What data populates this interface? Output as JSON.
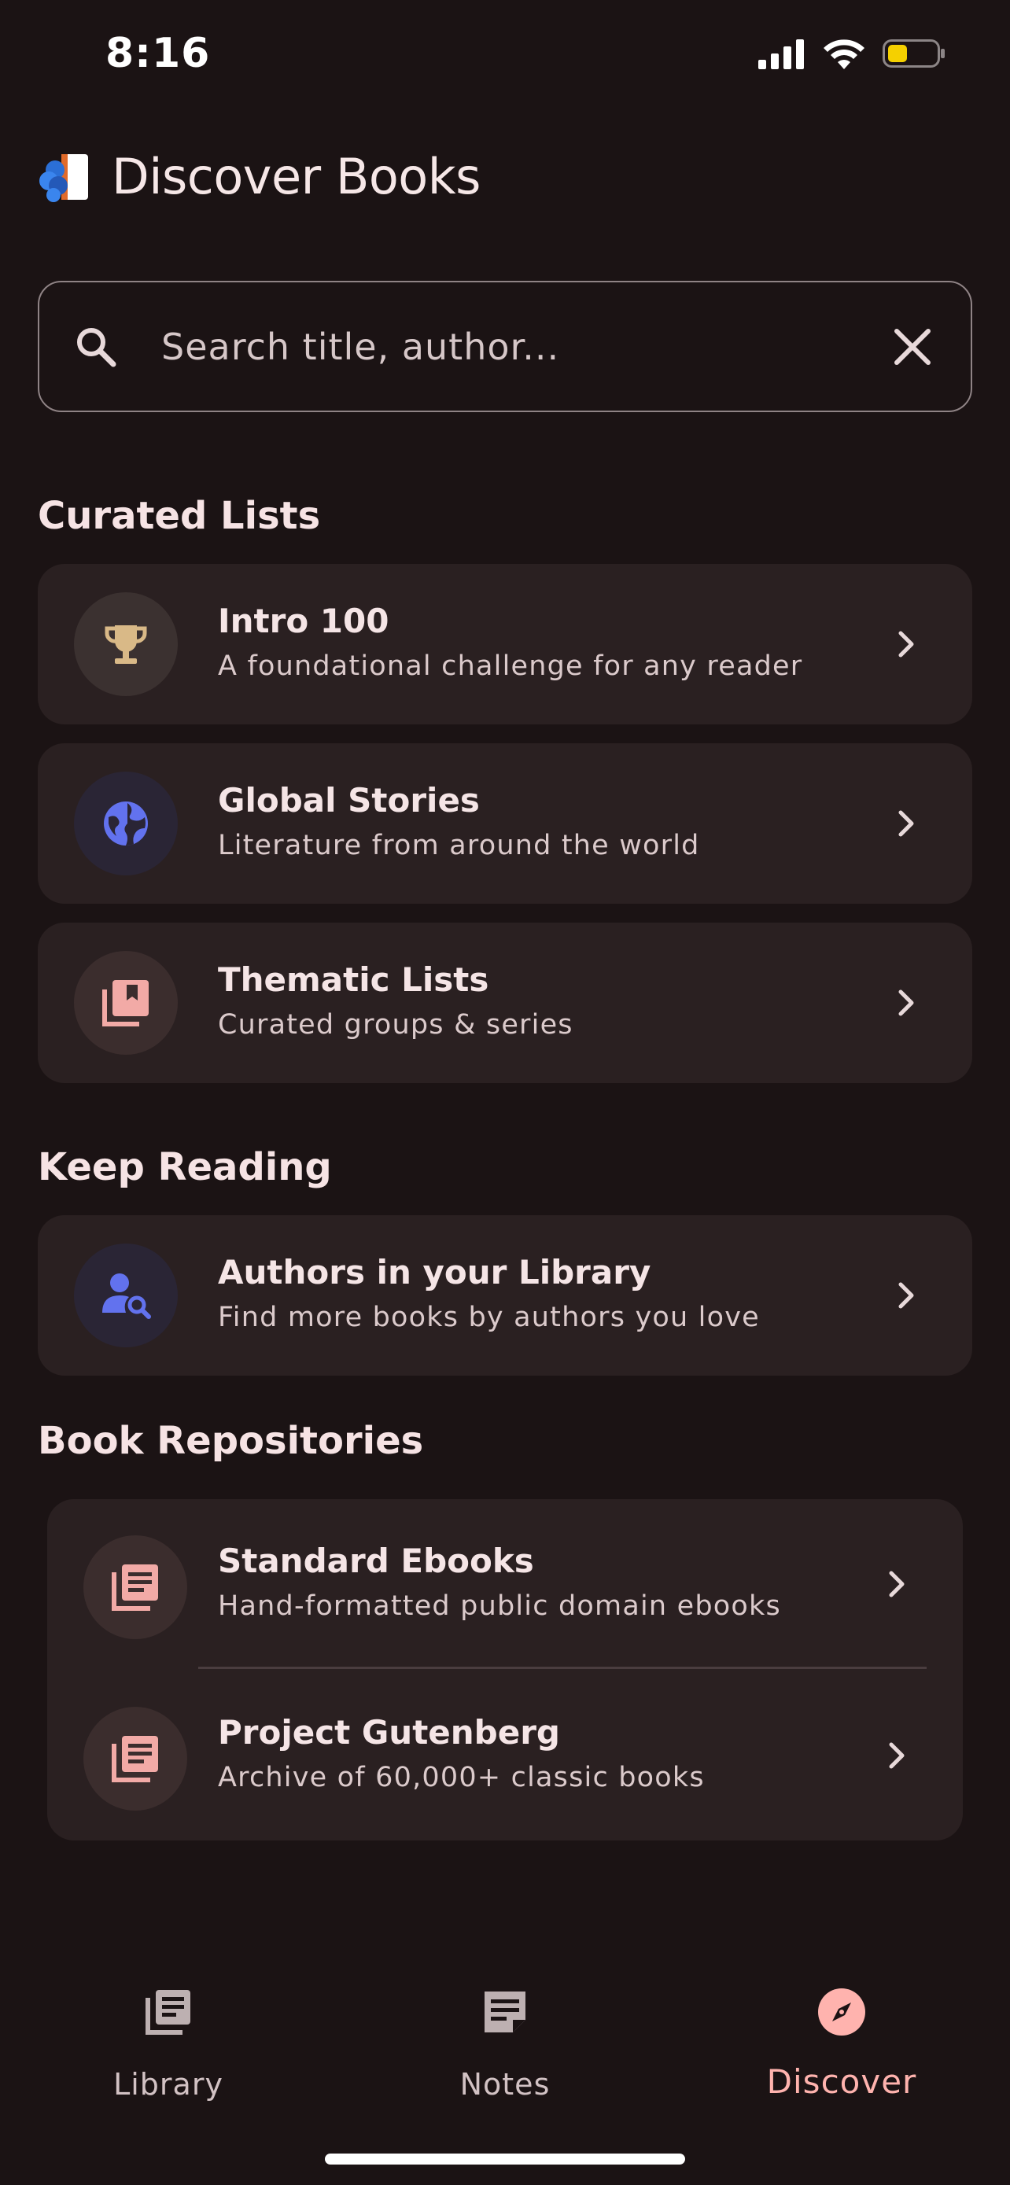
{
  "status_bar": {
    "time": "8:16",
    "icons": [
      "signal-icon",
      "wifi-icon",
      "battery-icon"
    ],
    "battery_color": "#f5d000"
  },
  "header": {
    "title": "Discover Books",
    "logo": "book-logo-icon"
  },
  "search": {
    "placeholder": "Search title, author...",
    "value": ""
  },
  "sections": {
    "curated": "Curated Lists",
    "keep_reading": "Keep Reading",
    "repositories": "Book Repositories"
  },
  "curated_lists": [
    {
      "title": "Intro 100",
      "subtitle": "A foundational challenge for any reader",
      "icon": "trophy-icon",
      "icon_color": "#d9b987",
      "icon_bg": "#3b3130"
    },
    {
      "title": "Global Stories",
      "subtitle": "Literature from around the world",
      "icon": "globe-icon",
      "icon_color": "#6272ee",
      "icon_bg": "#2a2535"
    },
    {
      "title": "Thematic Lists",
      "subtitle": "Curated groups & series",
      "icon": "bookmarks-icon",
      "icon_color": "#f2aaa6",
      "icon_bg": "#3b2d2d"
    }
  ],
  "keep_reading": [
    {
      "title": "Authors in your Library",
      "subtitle": "Find more books by authors you love",
      "icon": "person-search-icon",
      "icon_color": "#6272ee",
      "icon_bg": "#2a2535"
    }
  ],
  "repositories": [
    {
      "title": "Standard Ebooks",
      "subtitle": "Hand-formatted public domain ebooks",
      "icon": "library-icon",
      "icon_color": "#f2aaa6",
      "icon_bg": "#3b2d2d"
    },
    {
      "title": "Project Gutenberg",
      "subtitle": "Archive of 60,000+ classic books",
      "icon": "library-icon",
      "icon_color": "#f2aaa6",
      "icon_bg": "#3b2d2d"
    }
  ],
  "tabs": [
    {
      "label": "Library",
      "icon": "library-icon",
      "active": false
    },
    {
      "label": "Notes",
      "icon": "notes-icon",
      "active": false
    },
    {
      "label": "Discover",
      "icon": "compass-icon",
      "active": true
    }
  ],
  "colors": {
    "background": "#1b1314",
    "card": "#2a2021",
    "accent": "#ffb3ae",
    "text": "#f5e5e6"
  }
}
